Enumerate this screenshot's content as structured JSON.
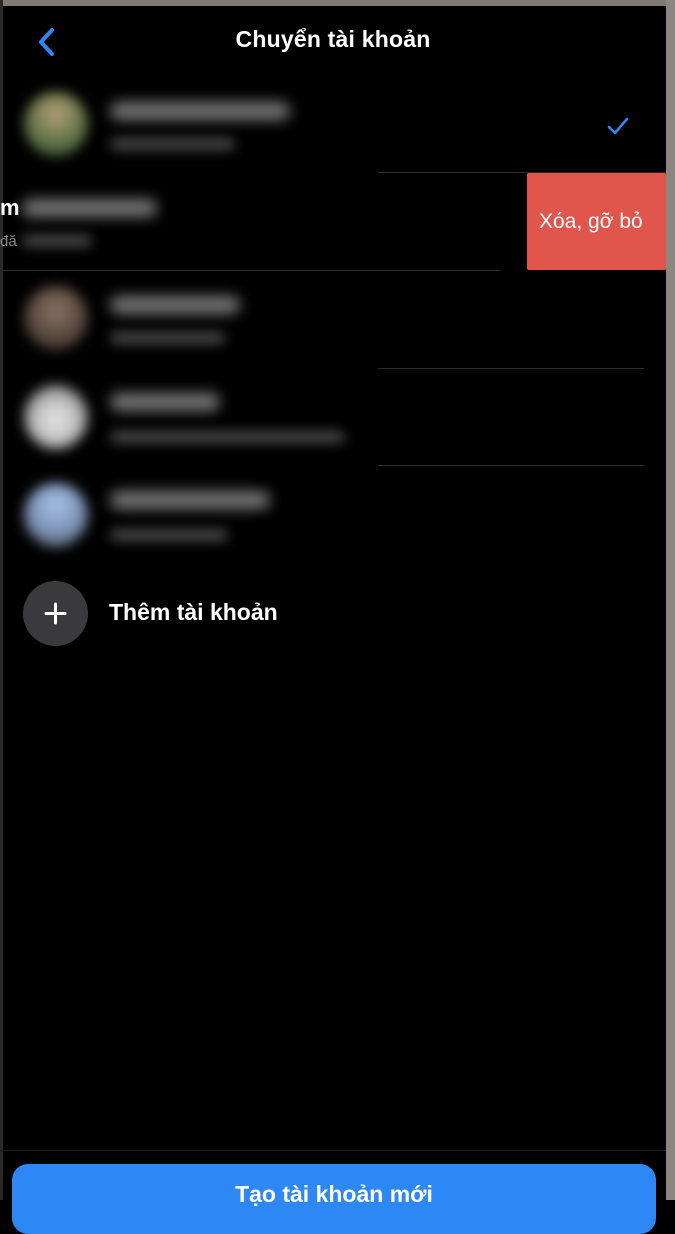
{
  "header": {
    "title": "Chuyển tài khoản",
    "back_icon": "chevron-left-icon"
  },
  "colors": {
    "accent": "#2d88f5",
    "delete": "#e0554c",
    "background": "#000000"
  },
  "accounts": {
    "selected_icon": "checkmark-icon"
  },
  "swipe_row": {
    "visible_name_fragment": "m",
    "visible_sub_fragment": "đă",
    "delete_label": "Xóa, gỡ bỏ"
  },
  "add_account": {
    "label": "Thêm tài khoản",
    "icon": "plus-icon"
  },
  "footer": {
    "create_label": "Tạo tài khoản mới"
  }
}
